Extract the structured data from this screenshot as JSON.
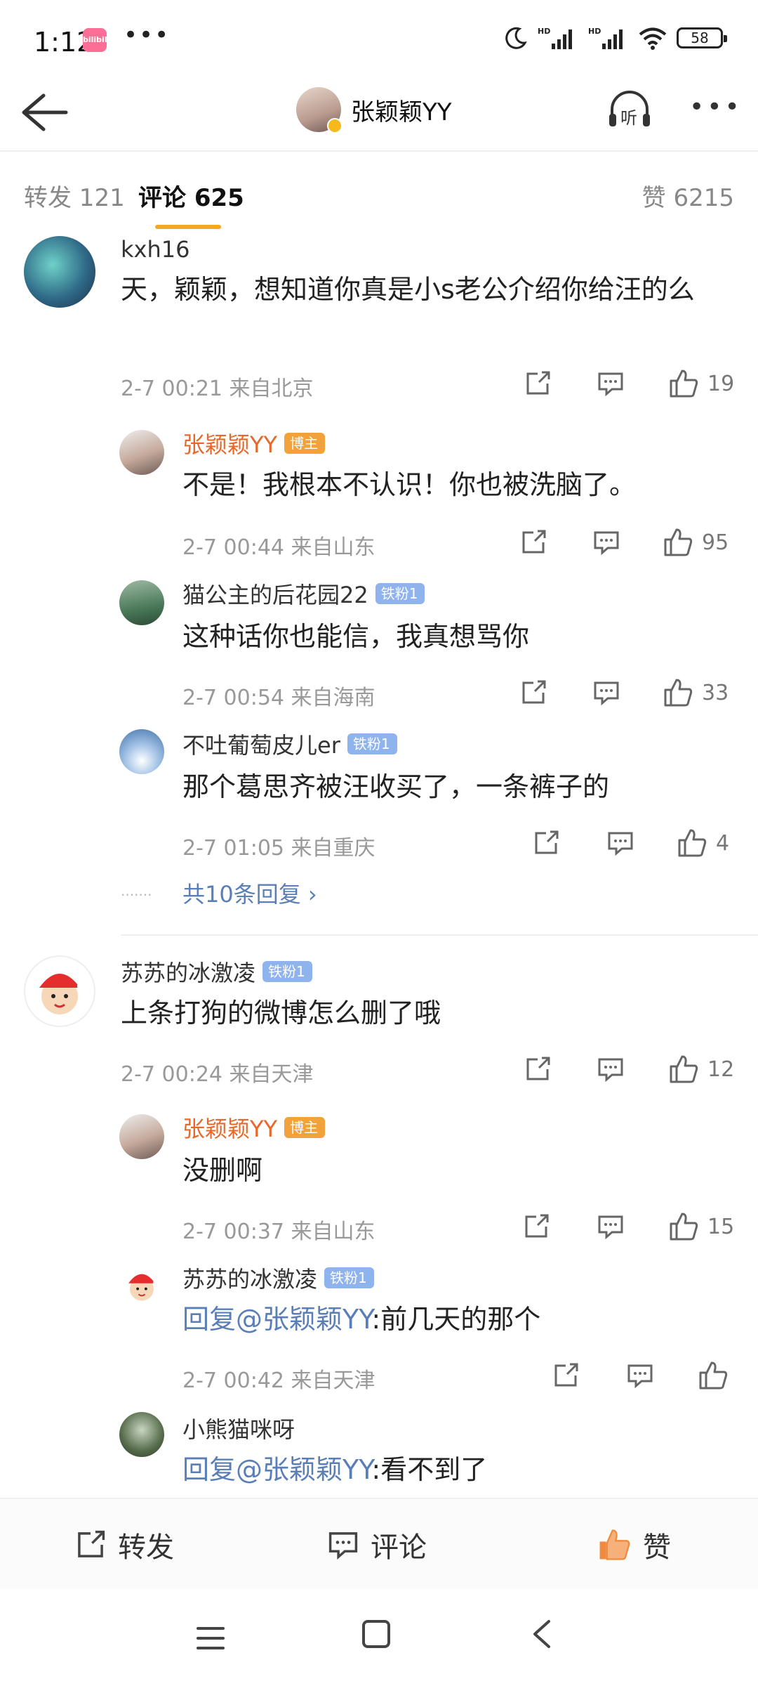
{
  "status_bar": {
    "time": "1:12",
    "app_badge": "bilibili",
    "dots": "•••",
    "battery": "58"
  },
  "header": {
    "title": "张颖颖YY",
    "listen_label": "听",
    "more": "•••"
  },
  "tabs": {
    "repost": "转发 121",
    "comment": "评论 625",
    "like": "赞 6215"
  },
  "comments": [
    {
      "user": "kxh16",
      "text": "天，颖颖，想知道你真是小s老公介绍你给汪的么",
      "time": "2-7 00:21",
      "location": "来自北京",
      "likes": "19",
      "replies": [
        {
          "user": "张颖颖YY",
          "badge": "博主",
          "text": "不是！我根本不认识！你也被洗脑了。",
          "time": "2-7 00:44",
          "location": "来自山东",
          "likes": "95"
        },
        {
          "user": "猫公主的后花园22",
          "badge": "铁粉1",
          "text": "这种话你也能信，我真想骂你",
          "time": "2-7 00:54",
          "location": "来自海南",
          "likes": "33"
        },
        {
          "user": "不吐葡萄皮儿er",
          "badge": "铁粉1",
          "text": "那个葛思齐被汪收买了，一条裤子的",
          "time": "2-7 01:05",
          "location": "来自重庆",
          "likes": "4"
        }
      ],
      "more_replies": "共10条回复 ›"
    },
    {
      "user": "苏苏的冰激凌",
      "badge": "铁粉1",
      "text": "上条打狗的微博怎么删了哦",
      "time": "2-7 00:24",
      "location": "来自天津",
      "likes": "12",
      "replies": [
        {
          "user": "张颖颖YY",
          "badge": "博主",
          "text": "没删啊",
          "time": "2-7 00:37",
          "location": "来自山东",
          "likes": "15"
        },
        {
          "user": "苏苏的冰激凌",
          "badge": "铁粉1",
          "mention": "回复@张颖颖YY",
          "text": ":前几天的那个",
          "time": "2-7 00:42",
          "location": "来自天津",
          "likes": ""
        },
        {
          "user": "小熊猫咪呀",
          "mention": "回复@张颖颖YY",
          "text": ":看不到了"
        }
      ]
    }
  ],
  "bottom_bar": {
    "repost": "转发",
    "comment": "评论",
    "like": "赞"
  },
  "colors": {
    "accent": "#f5a623",
    "owner_name": "#e8682a",
    "mention": "#5a7fb8",
    "fan_badge": "#8fb3ec",
    "like_active": "#f08a3e"
  }
}
